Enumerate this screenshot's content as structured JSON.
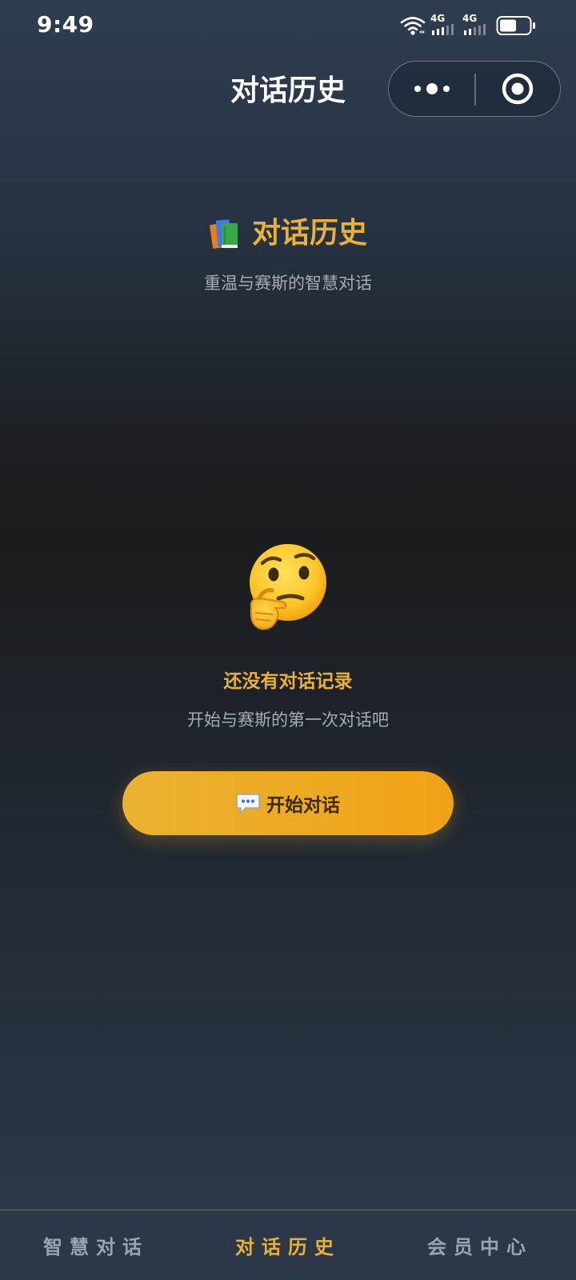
{
  "status_bar": {
    "time": "9:49",
    "network_1": "4G",
    "network_2": "4G",
    "icons": [
      "wifi-icon",
      "cellular-signal-icon",
      "cellular-signal-icon",
      "battery-icon"
    ]
  },
  "nav": {
    "title": "对话历史",
    "capsule_icons": [
      "more-icon",
      "close-target-icon"
    ]
  },
  "header": {
    "icon": "books-icon",
    "title": "对话历史",
    "subtitle": "重温与赛斯的智慧对话"
  },
  "empty_state": {
    "icon": "thinking-face-icon",
    "title": "还没有对话记录",
    "description": "开始与赛斯的第一次对话吧",
    "button_icon": "speech-bubble-icon",
    "button_label": "开始对话"
  },
  "tab_bar": {
    "items": [
      {
        "label": "智慧对话",
        "active": false
      },
      {
        "label": "对话历史",
        "active": true
      },
      {
        "label": "会员中心",
        "active": false
      }
    ]
  },
  "colors": {
    "accent": "#e8b23a",
    "button_start": "#ebb232",
    "button_end": "#f0a216",
    "muted_text": "#a3acb8",
    "tab_inactive": "#9aa3ae"
  }
}
